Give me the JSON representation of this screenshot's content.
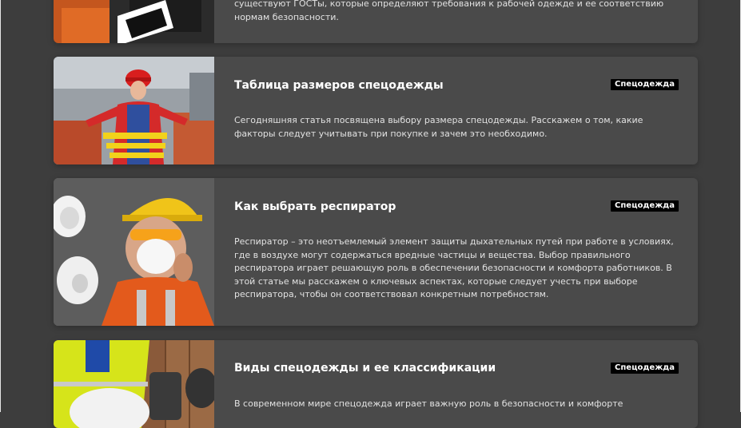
{
  "articles": [
    {
      "title": "",
      "tag": "",
      "text": "существуют ГОСТы, которые определяют требования к рабочей одежде и ее соответствию нормам безопасности."
    },
    {
      "title": "Таблица размеров спецодежды",
      "tag": "Спецодежда",
      "text": "Сегодняшняя статья посвящена выбору размера спецодежды. Расскажем о том, какие факторы следует учитывать при покупке и зачем это необходимо."
    },
    {
      "title": "Как выбрать респиратор",
      "tag": "Спецодежда",
      "text": "Респиратор – это неотъемлемый элемент защиты дыхательных путей при работе в условиях, где в воздухе могут содержаться вредные частицы и вещества. Выбор правильного респиратора играет решающую роль в обеспечении безопасности и комфорта работников. В этой статье мы расскажем о ключевых аспектах, которые следует учесть при выборе респиратора, чтобы он соответствовал конкретным потребностям."
    },
    {
      "title": "Виды спецодежды и ее классификации",
      "tag": "Спецодежда",
      "text": "В современном мире спецодежда играет важную роль в безопасности и комфорте"
    }
  ]
}
